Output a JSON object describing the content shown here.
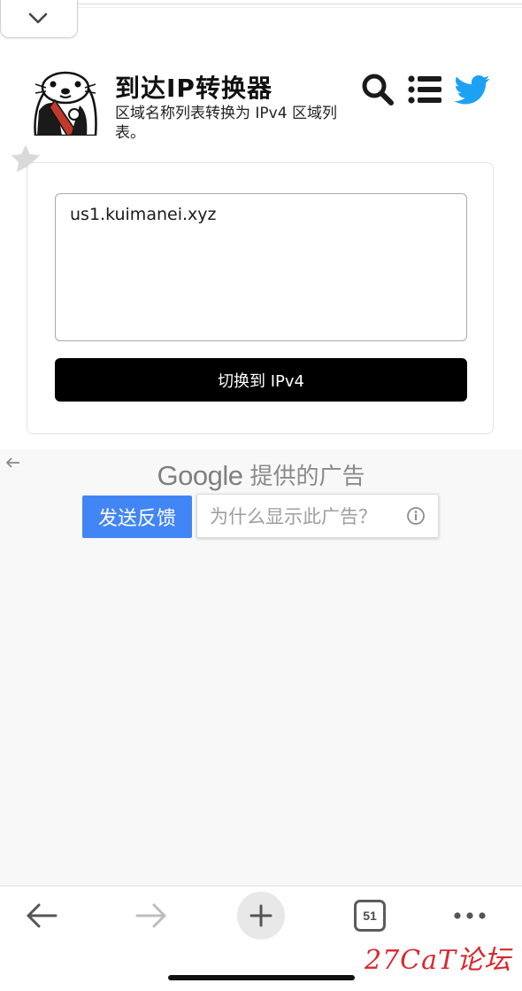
{
  "header": {
    "title": "到达IP转换器",
    "subtitle": "区域名称列表转换为 IPv4 区域列表。"
  },
  "icons": {
    "collapse": "chevron-down-icon",
    "search": "search-icon",
    "menu": "list-icon",
    "twitter": "twitter-icon",
    "favorite": "star-icon"
  },
  "converter": {
    "input_value": "us1.kuimanei.xyz",
    "button_label": "切换到 IPv4"
  },
  "ad": {
    "brand": "Google",
    "provided_label": "提供的广告",
    "feedback_label": "发送反馈",
    "why_label": "为什么显示此广告？"
  },
  "browser": {
    "tab_count": "51"
  },
  "watermark": "27CaT论坛",
  "colors": {
    "feedback_button": "#4285f4",
    "twitter_blue": "#1da1f2",
    "primary_button": "#000000",
    "watermark_red": "#d9272e"
  }
}
